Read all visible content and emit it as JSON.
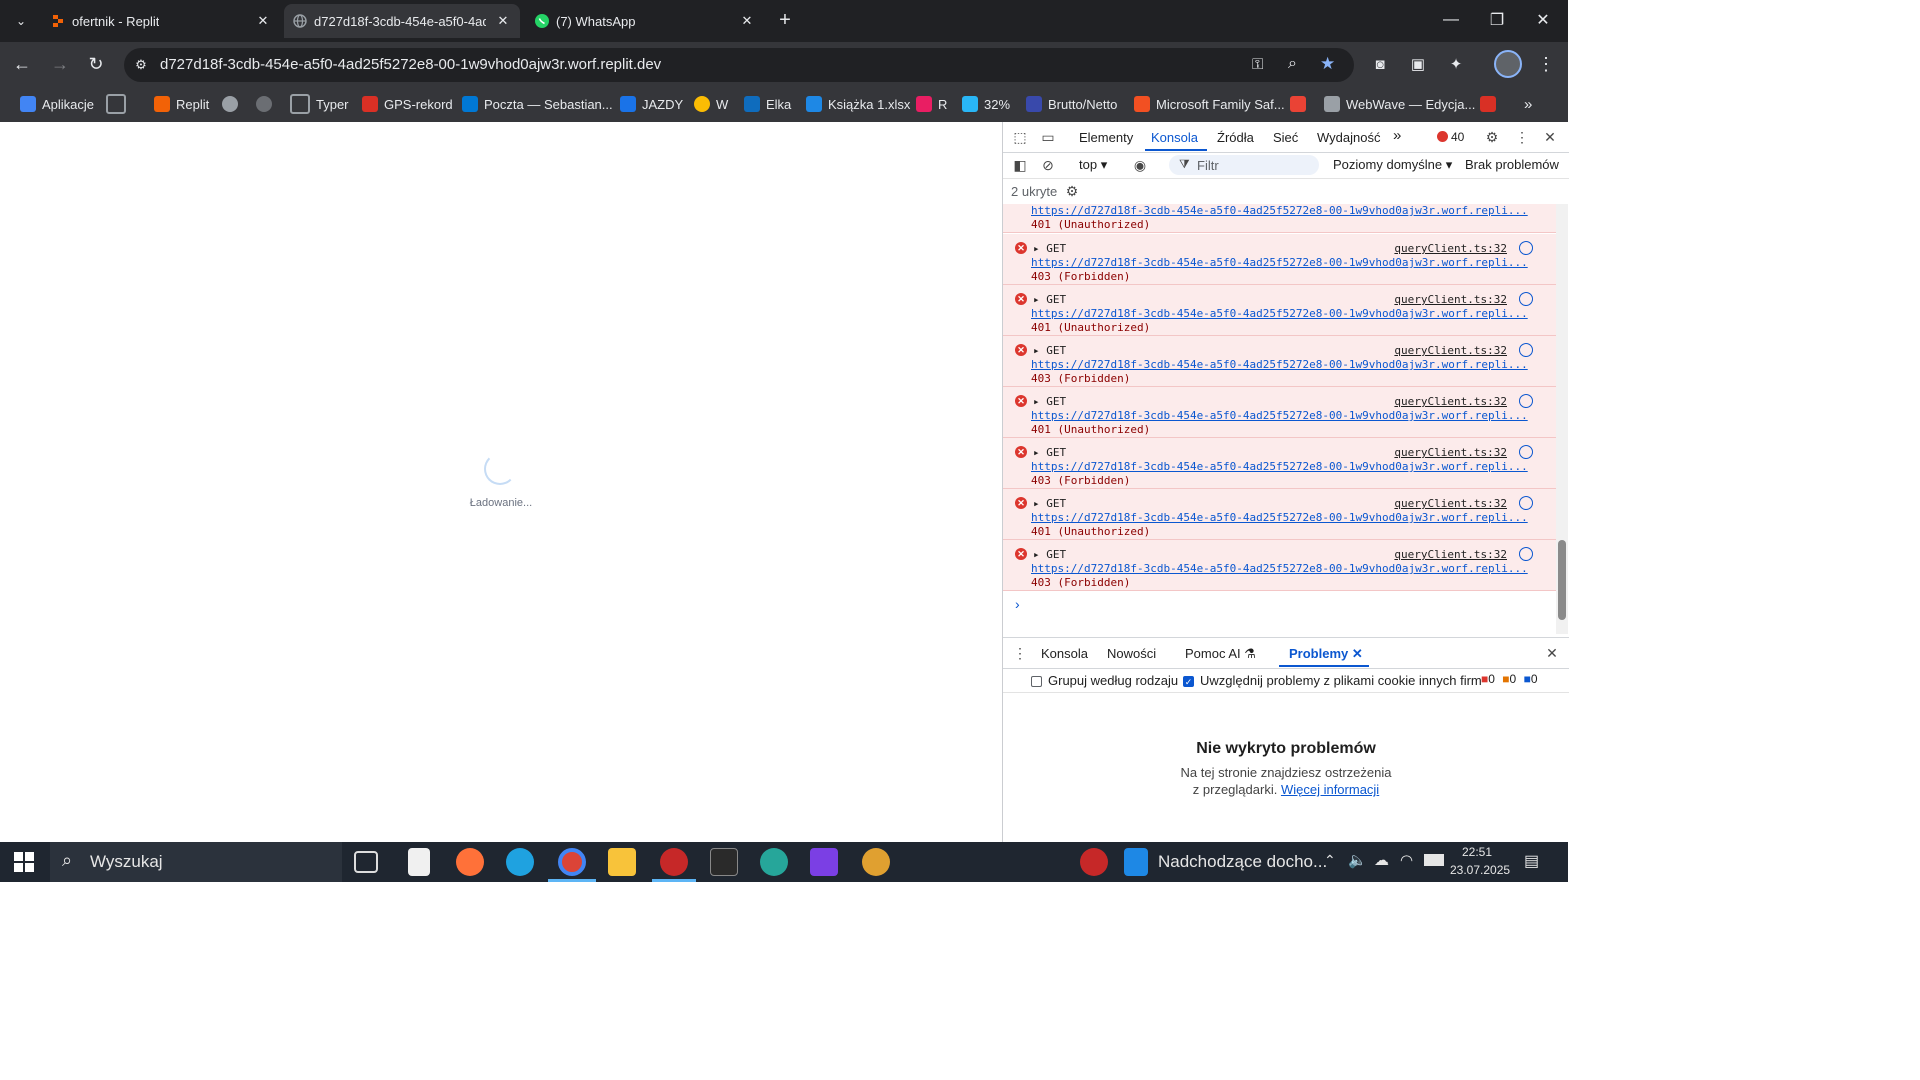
{
  "tabs": [
    {
      "title": "ofertnik - Replit",
      "active": false,
      "favicon": "replit-icon"
    },
    {
      "title": "d727d18f-3cdb-454e-a5f0-4ad",
      "active": true,
      "favicon": "globe-icon"
    },
    {
      "title": "(7) WhatsApp",
      "active": false,
      "favicon": "whatsapp-icon"
    }
  ],
  "address_bar": {
    "url": "d727d18f-3cdb-454e-a5f0-4ad25f5272e8-00-1w9vhod0ajw3r.worf.replit.dev"
  },
  "bookmarks": [
    {
      "label": "Aplikacje",
      "color": "#4285f4"
    },
    {
      "label": "",
      "color": "#9aa0a6"
    },
    {
      "label": "Replit",
      "color": "#f26207"
    },
    {
      "label": "",
      "color": "#9aa0a6"
    },
    {
      "label": "",
      "color": "#9aa0a6"
    },
    {
      "label": "Typer",
      "color": "#9aa0a6"
    },
    {
      "label": "GPS-rekord",
      "color": "#d93025"
    },
    {
      "label": "Poczta — Sebastian...",
      "color": "#0078d4"
    },
    {
      "label": "JAZDY",
      "color": "#1a73e8"
    },
    {
      "label": "W",
      "color": "#fbbc04"
    },
    {
      "label": "Elka",
      "color": "#0f6cbd"
    },
    {
      "label": "Książka 1.xlsx",
      "color": "#1e88e5"
    },
    {
      "label": "R",
      "color": "#e91e63"
    },
    {
      "label": "32%",
      "color": "#29b6f6"
    },
    {
      "label": "Brutto/Netto",
      "color": "#3949ab"
    },
    {
      "label": "Microsoft Family Saf...",
      "color": "#f25022"
    },
    {
      "label": "",
      "color": "#ea4335"
    },
    {
      "label": "WebWave — Edycja...",
      "color": "#9aa0a6"
    },
    {
      "label": "",
      "color": "#d93025"
    }
  ],
  "page": {
    "loading_text": "Ładowanie..."
  },
  "devtools": {
    "tabs": [
      "Elementy",
      "Konsola",
      "Źródła",
      "Sieć",
      "Wydajność"
    ],
    "more": "»",
    "error_count": "40",
    "context": "top",
    "filter_placeholder": "Filtr",
    "levels": "Poziomy domyślne",
    "issues": "Brak problemów",
    "hidden": "2 ukryte",
    "first_entry": {
      "url": "https://d727d18f-3cdb-454e-a5f0-4ad25f5272e8-00-1w9vhod0ajw3r.worf.repli...",
      "status": "401 (Unauthorized)"
    },
    "entries": [
      {
        "method": "GET",
        "source": "queryClient.ts:32",
        "url": "https://d727d18f-3cdb-454e-a5f0-4ad25f5272e8-00-1w9vhod0ajw3r.worf.repli...",
        "status": "403 (Forbidden)"
      },
      {
        "method": "GET",
        "source": "queryClient.ts:32",
        "url": "https://d727d18f-3cdb-454e-a5f0-4ad25f5272e8-00-1w9vhod0ajw3r.worf.repli...",
        "status": "401 (Unauthorized)"
      },
      {
        "method": "GET",
        "source": "queryClient.ts:32",
        "url": "https://d727d18f-3cdb-454e-a5f0-4ad25f5272e8-00-1w9vhod0ajw3r.worf.repli...",
        "status": "403 (Forbidden)"
      },
      {
        "method": "GET",
        "source": "queryClient.ts:32",
        "url": "https://d727d18f-3cdb-454e-a5f0-4ad25f5272e8-00-1w9vhod0ajw3r.worf.repli...",
        "status": "401 (Unauthorized)"
      },
      {
        "method": "GET",
        "source": "queryClient.ts:32",
        "url": "https://d727d18f-3cdb-454e-a5f0-4ad25f5272e8-00-1w9vhod0ajw3r.worf.repli...",
        "status": "403 (Forbidden)"
      },
      {
        "method": "GET",
        "source": "queryClient.ts:32",
        "url": "https://d727d18f-3cdb-454e-a5f0-4ad25f5272e8-00-1w9vhod0ajw3r.worf.repli...",
        "status": "401 (Unauthorized)"
      },
      {
        "method": "GET",
        "source": "queryClient.ts:32",
        "url": "https://d727d18f-3cdb-454e-a5f0-4ad25f5272e8-00-1w9vhod0ajw3r.worf.repli...",
        "status": "403 (Forbidden)"
      }
    ],
    "drawer": {
      "tabs": [
        "Konsola",
        "Nowości",
        "Pomoc AI",
        "Problemy"
      ],
      "group_label": "Grupuj według rodzaju",
      "cookie_label": "Uwzględnij problemy z plikami cookie innych firm",
      "counts": [
        "0",
        "0",
        "0"
      ],
      "empty_title": "Nie wykryto problemów",
      "empty_line1": "Na tej stronie znajdziesz ostrzeżenia",
      "empty_line2": "z przeglądarki.",
      "more_link": "Więcej informacji"
    }
  },
  "taskbar": {
    "search_placeholder": "Wyszukaj",
    "notification": "Nadchodzące docho...",
    "time": "22:51",
    "date": "23.07.2025"
  }
}
